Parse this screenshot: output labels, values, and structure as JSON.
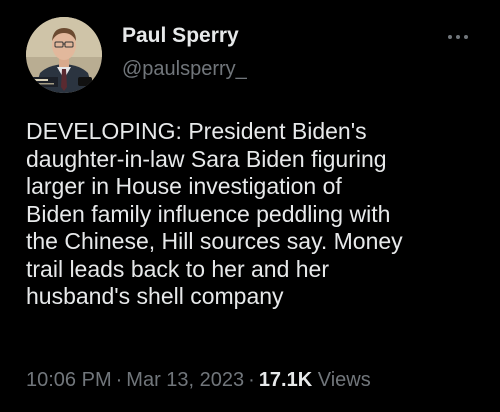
{
  "author": {
    "display_name": "Paul Sperry",
    "handle": "@paulsperry_"
  },
  "tweet": {
    "lines": [
      "DEVELOPING: President Biden's",
      "daughter-in-law Sara Biden figuring",
      "larger in House investigation of",
      "Biden family influence peddling with",
      "the Chinese, Hill sources say. Money",
      "trail leads back to her and her",
      "husband's shell company"
    ]
  },
  "meta": {
    "time": "10:06 PM",
    "separator": "·",
    "date": "Mar 13, 2023",
    "views_count": "17.1K",
    "views_label": "Views"
  },
  "icons": {
    "more": "more-horizontal-icon"
  },
  "colors": {
    "background": "#000000",
    "primary_text": "#e7e9ea",
    "secondary_text": "#71767b"
  }
}
